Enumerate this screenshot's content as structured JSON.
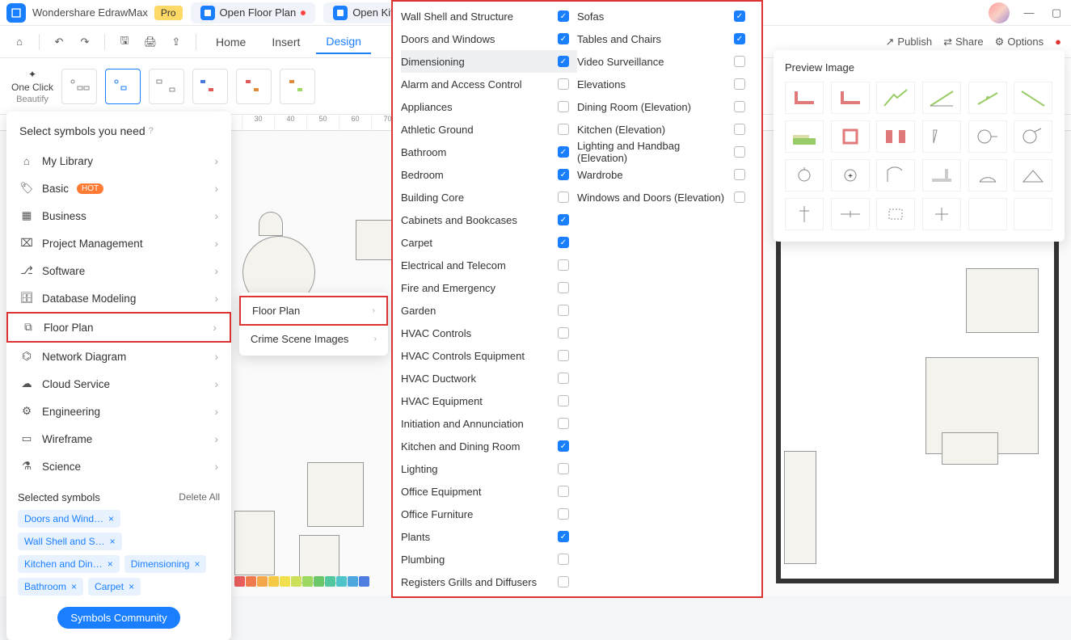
{
  "app": {
    "name": "Wondershare EdrawMax",
    "pro": "Pro"
  },
  "tabs": [
    {
      "label": "Open Floor Plan",
      "modified": true
    },
    {
      "label": "Open Kitche"
    }
  ],
  "toolbar_right": {
    "publish": "Publish",
    "share": "Share",
    "options": "Options"
  },
  "menu": {
    "home": "Home",
    "insert": "Insert",
    "design": "Design"
  },
  "beautify": {
    "label_top": "One Click",
    "label_bottom": "Beautify",
    "trail": "utify"
  },
  "ruler": [
    "30",
    "40",
    "50",
    "60",
    "70"
  ],
  "panel": {
    "title": "Select symbols you need",
    "categories": [
      {
        "label": "My Library",
        "icon": "home"
      },
      {
        "label": "Basic",
        "icon": "tag",
        "hot": "HOT"
      },
      {
        "label": "Business",
        "icon": "grid"
      },
      {
        "label": "Project Management",
        "icon": "pm"
      },
      {
        "label": "Software",
        "icon": "sw"
      },
      {
        "label": "Database Modeling",
        "icon": "db"
      },
      {
        "label": "Floor Plan",
        "icon": "fp",
        "highlighted": true
      },
      {
        "label": "Network Diagram",
        "icon": "net"
      },
      {
        "label": "Cloud Service",
        "icon": "cloud"
      },
      {
        "label": "Engineering",
        "icon": "eng"
      },
      {
        "label": "Wireframe",
        "icon": "wf"
      },
      {
        "label": "Science",
        "icon": "sci"
      }
    ],
    "selected_title": "Selected symbols",
    "delete_all": "Delete All",
    "chips": [
      "Doors and Wind…",
      "Wall Shell and S…",
      "Kitchen and Din…",
      "Dimensioning",
      "Bathroom",
      "Carpet"
    ],
    "community": "Symbols Community"
  },
  "submenu": {
    "items": [
      {
        "label": "Floor Plan",
        "highlighted": true
      },
      {
        "label": "Crime Scene Images"
      }
    ]
  },
  "checks": {
    "left": [
      {
        "label": "Wall Shell and Structure",
        "on": true
      },
      {
        "label": "Doors and Windows",
        "on": true
      },
      {
        "label": "Dimensioning",
        "on": true,
        "hl": true
      },
      {
        "label": "Alarm and Access Control",
        "on": false
      },
      {
        "label": "Appliances",
        "on": false
      },
      {
        "label": "Athletic Ground",
        "on": false
      },
      {
        "label": "Bathroom",
        "on": true
      },
      {
        "label": "Bedroom",
        "on": true
      },
      {
        "label": "Building Core",
        "on": false
      },
      {
        "label": "Cabinets and Bookcases",
        "on": true
      },
      {
        "label": "Carpet",
        "on": true
      },
      {
        "label": "Electrical and Telecom",
        "on": false
      },
      {
        "label": "Fire and Emergency",
        "on": false
      },
      {
        "label": "Garden",
        "on": false
      },
      {
        "label": "HVAC Controls",
        "on": false
      },
      {
        "label": "HVAC Controls Equipment",
        "on": false
      },
      {
        "label": "HVAC Ductwork",
        "on": false
      },
      {
        "label": "HVAC Equipment",
        "on": false
      },
      {
        "label": "Initiation and Annunciation",
        "on": false
      },
      {
        "label": "Kitchen and Dining Room",
        "on": true
      },
      {
        "label": "Lighting",
        "on": false
      },
      {
        "label": "Office Equipment",
        "on": false
      },
      {
        "label": "Office Furniture",
        "on": false
      },
      {
        "label": "Plants",
        "on": true
      },
      {
        "label": "Plumbing",
        "on": false
      },
      {
        "label": "Registers Grills and Diffusers",
        "on": false
      }
    ],
    "right": [
      {
        "label": "Sofas",
        "on": true
      },
      {
        "label": "Tables and Chairs",
        "on": true
      },
      {
        "label": "Video Surveillance",
        "on": false
      },
      {
        "label": "Elevations",
        "on": false
      },
      {
        "label": "Dining Room (Elevation)",
        "on": false
      },
      {
        "label": "Kitchen (Elevation)",
        "on": false
      },
      {
        "label": "Lighting and Handbag (Elevation)",
        "on": false
      },
      {
        "label": "Wardrobe",
        "on": false
      },
      {
        "label": "Windows and Doors (Elevation)",
        "on": false
      }
    ]
  },
  "preview": {
    "title": "Preview Image"
  },
  "colors": {
    "warm": [
      "#e85c5c",
      "#ef7a4d",
      "#f2a84a",
      "#f6c945",
      "#f1e04b",
      "#cde05a",
      "#9dd860",
      "#6cc66a",
      "#52c7a0",
      "#4fc4c9",
      "#4ea6df",
      "#4f7de0"
    ],
    "cool": [
      "#5a4b41",
      "#6d5749",
      "#80634f",
      "#8e6f56",
      "#9b7b5d",
      "#a98864",
      "#b7946c",
      "#c4a073",
      "#d2ad7b",
      "#dfba83",
      "#eac78c"
    ],
    "gray": [
      "#1b1b1b",
      "#333",
      "#555",
      "#777",
      "#999",
      "#bbb",
      "#ddd",
      "#f0f0f0",
      "#fff"
    ]
  }
}
